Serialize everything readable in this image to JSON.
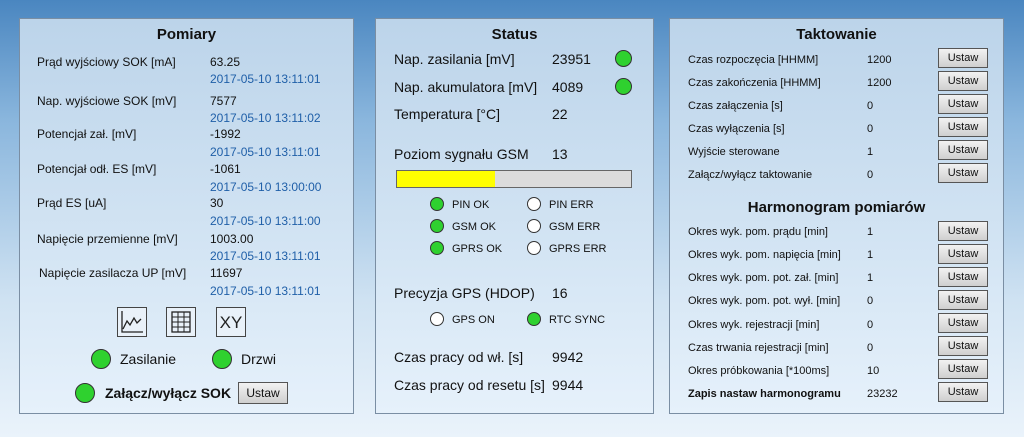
{
  "pomiary": {
    "title": "Pomiary",
    "rows": [
      {
        "label": "Prąd wyjściowy SOK [mA]",
        "value": "63.25",
        "ts": "2017-05-10 13:11:01"
      },
      {
        "label": "Nap. wyjściowe SOK [mV]",
        "value": "7577",
        "ts": "2017-05-10 13:11:02"
      },
      {
        "label": "Potencjał zał. [mV]",
        "value": "-1992",
        "ts": "2017-05-10 13:11:01"
      },
      {
        "label": "Potencjał odł. ES [mV]",
        "value": "-1061",
        "ts": "2017-05-10 13:00:00"
      },
      {
        "label": "Prąd ES [uA]",
        "value": "30",
        "ts": "2017-05-10 13:11:00"
      },
      {
        "label": "Napięcie przemienne [mV]",
        "value": "1003.00",
        "ts": "2017-05-10 13:11:01"
      },
      {
        "label": "Napięcie zasilacza UP [mV]",
        "value": "11697",
        "ts": "2017-05-10 13:11:01"
      }
    ],
    "icons": [
      "line-chart-icon",
      "table-icon",
      "xy-plot-icon"
    ],
    "xy_text": "XY",
    "zasilanie": "Zasilanie",
    "drzwi": "Drzwi",
    "sok_label": "Załącz/wyłącz SOK",
    "sok_button": "Ustaw"
  },
  "status": {
    "title": "Status",
    "rows": [
      {
        "label": "Nap. zasilania [mV]",
        "value": "23951"
      },
      {
        "label": "Nap. akumulatora [mV]",
        "value": "4089"
      },
      {
        "label": "Temperatura [°C]",
        "value": "22"
      }
    ],
    "gsm_label": "Poziom sygnału GSM",
    "gsm_value": "13",
    "gsm_fraction": 0.42,
    "gsm_indicators": [
      {
        "label": "PIN OK",
        "on": true
      },
      {
        "label": "PIN ERR",
        "on": false
      },
      {
        "label": "GSM OK",
        "on": true
      },
      {
        "label": "GSM ERR",
        "on": false
      },
      {
        "label": "GPRS OK",
        "on": true
      },
      {
        "label": "GPRS ERR",
        "on": false
      }
    ],
    "gps_label": "Precyzja GPS (HDOP)",
    "gps_value": "16",
    "gps_indicators": [
      {
        "label": "GPS ON",
        "on": false
      },
      {
        "label": "RTC SYNC",
        "on": true
      }
    ],
    "uptime_label": "Czas pracy od wł. [s]",
    "uptime_value": "9942",
    "reset_label": "Czas pracy od resetu [s]",
    "reset_value": "9944"
  },
  "taktowanie": {
    "title": "Taktowanie",
    "rows": [
      {
        "label": "Czas rozpoczęcia [HHMM]",
        "value": "1200",
        "button": "Ustaw"
      },
      {
        "label": "Czas zakończenia [HHMM]",
        "value": "1200",
        "button": "Ustaw"
      },
      {
        "label": "Czas załączenia [s]",
        "value": "0",
        "button": "Ustaw"
      },
      {
        "label": "Czas wyłączenia [s]",
        "value": "0",
        "button": "Ustaw"
      },
      {
        "label": "Wyjście sterowane",
        "value": "1",
        "button": "Ustaw"
      },
      {
        "label": "Załącz/wyłącz taktowanie",
        "value": "0",
        "button": "Ustaw"
      }
    ],
    "harmonogram_title": "Harmonogram pomiarów",
    "harmonogram": [
      {
        "label": "Okres wyk. pom. prądu [min]",
        "value": "1",
        "button": "Ustaw"
      },
      {
        "label": "Okres wyk. pom. napięcia [min]",
        "value": "1",
        "button": "Ustaw"
      },
      {
        "label": "Okres wyk. pom. pot. zał. [min]",
        "value": "1",
        "button": "Ustaw"
      },
      {
        "label": "Okres wyk. pom. pot. wył. [min]",
        "value": "0",
        "button": "Ustaw"
      },
      {
        "label": "Okres wyk. rejestracji [min]",
        "value": "0",
        "button": "Ustaw"
      },
      {
        "label": "Czas trwania rejestracji [min]",
        "value": "0",
        "button": "Ustaw"
      },
      {
        "label": "Okres próbkowania [*100ms]",
        "value": "10",
        "button": "Ustaw"
      }
    ],
    "save_label": "Zapis nastaw harmonogramu",
    "save_value": "23232",
    "save_button": "Ustaw"
  }
}
